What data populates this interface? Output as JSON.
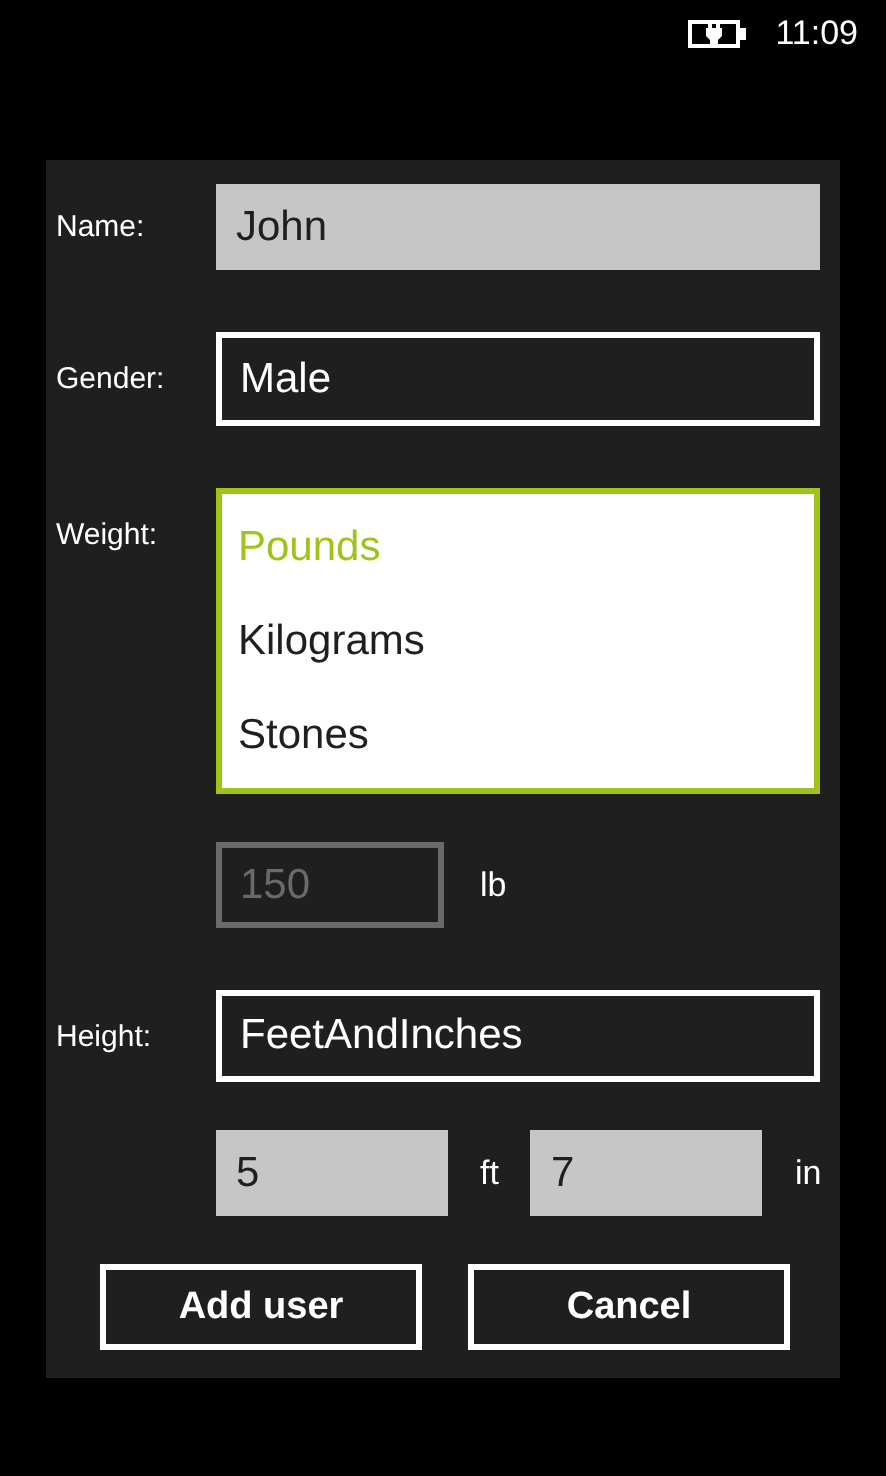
{
  "status_bar": {
    "time": "11:09"
  },
  "form": {
    "name": {
      "label": "Name:",
      "value": "John"
    },
    "gender": {
      "label": "Gender:",
      "value": "Male"
    },
    "weight": {
      "label": "Weight:",
      "options": [
        {
          "label": "Pounds",
          "selected": true
        },
        {
          "label": "Kilograms",
          "selected": false
        },
        {
          "label": "Stones",
          "selected": false
        }
      ],
      "value": "150",
      "unit": "lb",
      "disabled": true
    },
    "height": {
      "label": "Height:",
      "value": "FeetAndInches",
      "feet": "5",
      "feet_unit": "ft",
      "inches": "7",
      "inches_unit": "in"
    }
  },
  "buttons": [
    {
      "label": "Add user"
    },
    {
      "label": "Cancel"
    }
  ]
}
